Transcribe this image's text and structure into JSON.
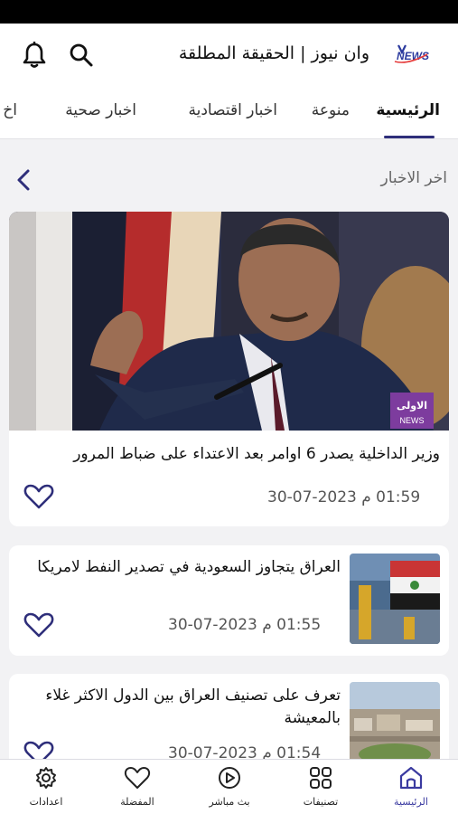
{
  "app": {
    "title": "وان نيوز | الحقيقة المطلقة",
    "logo_text": "NEWS",
    "icons": {
      "search": "search-icon",
      "notifications": "bell-icon"
    }
  },
  "tabs": [
    {
      "label": "الرئيسية",
      "active": true
    },
    {
      "label": "منوعة",
      "active": false
    },
    {
      "label": "اخبار اقتصادية",
      "active": false
    },
    {
      "label": "اخبار صحية",
      "active": false
    },
    {
      "label": "اخ",
      "active": false
    }
  ],
  "section": {
    "title": "اخر الاخبار",
    "more_icon": "chevron-left-icon"
  },
  "featured": {
    "title": "وزير الداخلية يصدر 6 اوامر بعد الاعتداء على ضباط المرور",
    "time": "01:59 م 2023-07-30",
    "image_badge": "الاولى",
    "image_badge_sub": "NEWS",
    "favorite_icon": "heart-icon"
  },
  "news": [
    {
      "title": "العراق يتجاوز السعودية في تصدير النفط لامريكا",
      "time": "01:55 م 2023-07-30",
      "favorite_icon": "heart-icon"
    },
    {
      "title": "تعرف على تصنيف العراق بين الدول الاكثر غلاء بالمعيشة",
      "time": "01:54 م 2023-07-30",
      "favorite_icon": "heart-icon"
    }
  ],
  "bottom_nav": [
    {
      "label": "الرئيسية",
      "icon": "home-icon",
      "active": true
    },
    {
      "label": "تصنيفات",
      "icon": "grid-icon",
      "active": false
    },
    {
      "label": "بث مباشر",
      "icon": "play-icon",
      "active": false
    },
    {
      "label": "المفضلة",
      "icon": "heart-icon",
      "active": false
    },
    {
      "label": "اعدادات",
      "icon": "gear-icon",
      "active": false
    }
  ],
  "colors": {
    "accent": "#2e2e7a",
    "background": "#f2f2f4",
    "card": "#ffffff"
  }
}
